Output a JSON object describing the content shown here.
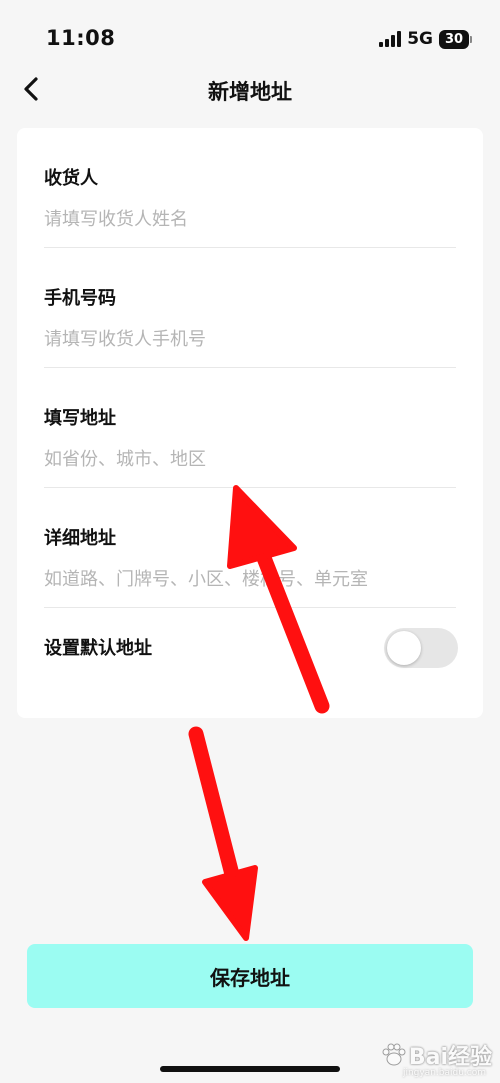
{
  "status_bar": {
    "time": "11:08",
    "network": "5G",
    "battery": "30"
  },
  "nav": {
    "title": "新增地址"
  },
  "form": {
    "fields": [
      {
        "label": "收货人",
        "placeholder": "请填写收货人姓名",
        "value": ""
      },
      {
        "label": "手机号码",
        "placeholder": "请填写收货人手机号",
        "value": ""
      },
      {
        "label": "填写地址",
        "placeholder": "如省份、城市、地区",
        "value": ""
      },
      {
        "label": "详细地址",
        "placeholder": "如道路、门牌号、小区、楼栋号、单元室",
        "value": ""
      }
    ],
    "default_label": "设置默认地址",
    "default_on": false
  },
  "save_button": {
    "label": "保存地址"
  },
  "colors": {
    "accent": "#9bfcf2",
    "arrow": "#ff1010",
    "background": "#f6f6f6"
  },
  "watermark": {
    "text": "Bai经验",
    "sub": "jingyan.baidu.com"
  }
}
